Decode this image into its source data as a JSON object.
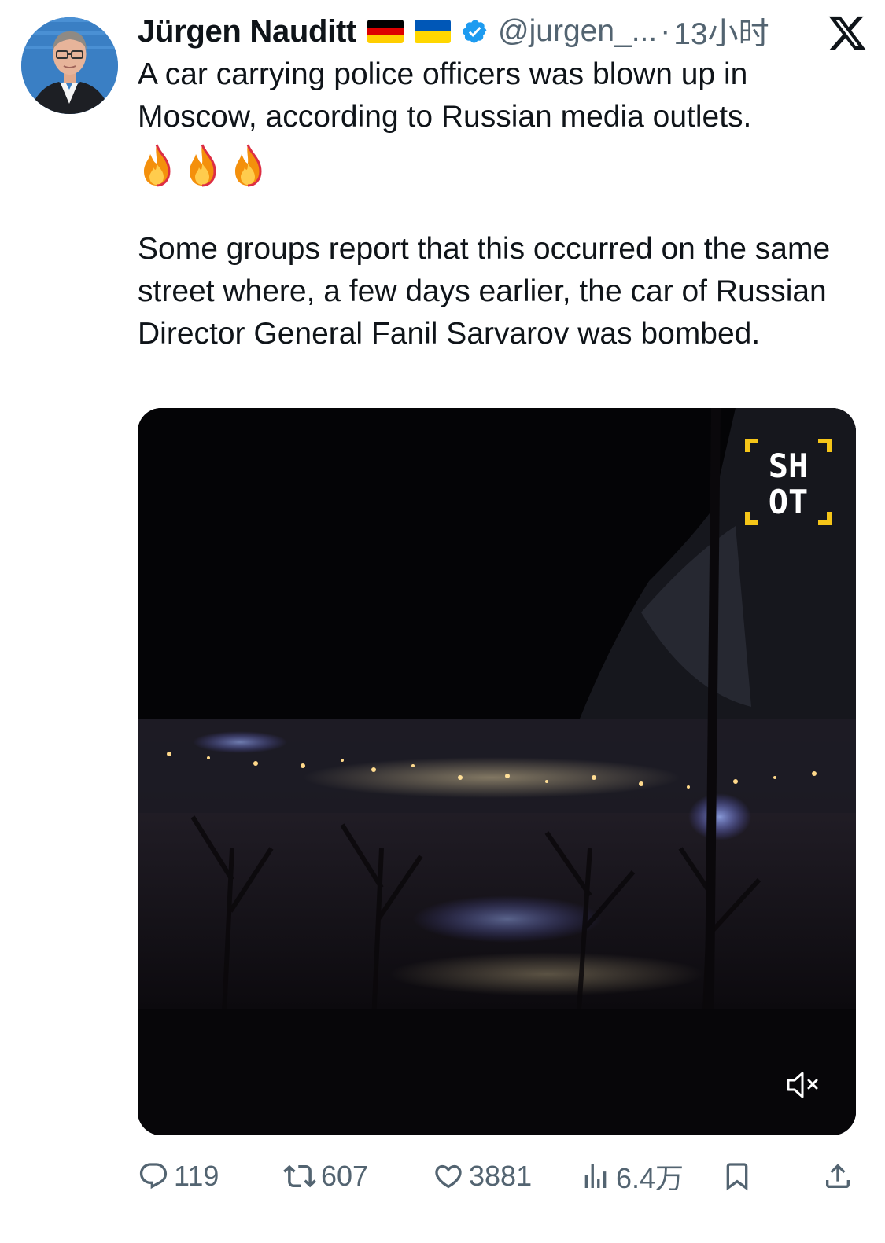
{
  "author": {
    "name": "Jürgen Nauditt",
    "handle": "@jurgen_...",
    "separator": "·",
    "time": "13小时",
    "verified": true,
    "flags": [
      "germany-flag",
      "ukraine-flag"
    ]
  },
  "tweet": {
    "paragraph1": "A car carrying police officers was blown up in Moscow, according to Russian media outlets.",
    "emojis": [
      "🔥",
      "🔥",
      "🔥"
    ],
    "paragraph2": "Some groups report that this occurred on the same street where, a few days earlier, the car of Russian Director General Fanil Sarvarov was bombed."
  },
  "media": {
    "watermark_line1": "SH",
    "watermark_line2": "OT",
    "muted": true
  },
  "actions": {
    "replies": "119",
    "retweets": "607",
    "likes": "3881",
    "views": "6.4万"
  },
  "colors": {
    "text": "#0f1419",
    "secondary": "#536471",
    "verified_blue": "#1d9bf0",
    "shot_yellow": "#f5c518"
  }
}
